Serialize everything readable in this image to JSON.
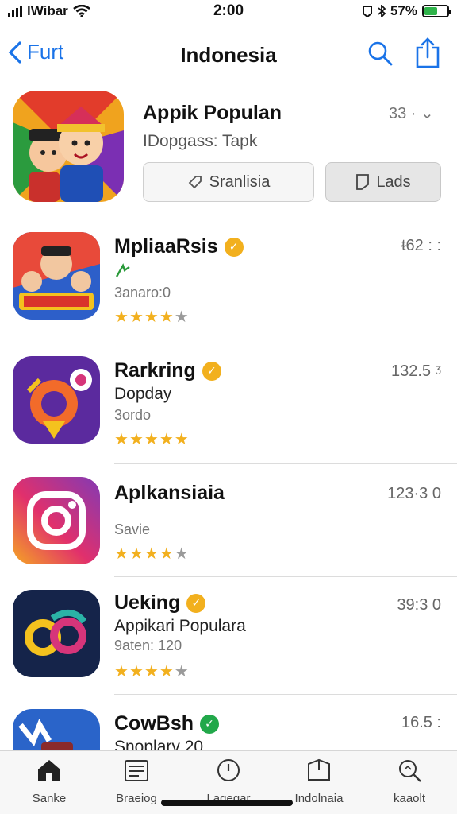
{
  "status_bar": {
    "carrier": "lWibar",
    "time": "2:00",
    "battery_text": "57%",
    "battery_level": 0.57,
    "battery_color": "#2fb34a"
  },
  "nav": {
    "back_label": "Furt",
    "title": "Indonesia",
    "accent_color": "#1a73e8"
  },
  "featured": {
    "name": "Appik Populan",
    "subtitle": "IDopgass: Tapk",
    "meta": "33 · ⌄",
    "button1_label": "Sranlisia",
    "button2_label": "Lads",
    "icon": "app-art-characters"
  },
  "apps": [
    {
      "name": "MpliaaRsis",
      "line2": "",
      "line3": "3anaro:0",
      "meta": "ᵵ62 : :",
      "rating": 3.5,
      "badge": "gold",
      "icon": "game-characters-icon"
    },
    {
      "name": "Rarkring",
      "line2": "Dopday",
      "line3": "3ordo",
      "meta": "132.5 ᶾ",
      "rating": 4.5,
      "badge": "gold",
      "icon": "location-pin-app-icon"
    },
    {
      "name": "Aplkansiaia",
      "line2": "",
      "line3": "Savie",
      "meta": "123·3 0",
      "rating": 4,
      "badge": "",
      "icon": "camera-app-icon"
    },
    {
      "name": "Ueking",
      "line2": "Appikari Populara",
      "line3": "9aten: 120",
      "meta": "39:3 0",
      "rating": 4,
      "badge": "gold",
      "icon": "swirl-app-icon"
    },
    {
      "name": "CowBsh",
      "line2": "Snoplary 20",
      "line3": "",
      "meta": "16.5 :",
      "rating": 0,
      "badge": "green",
      "icon": "cowbsh-app-icon"
    }
  ],
  "tabs": [
    {
      "label": "Sanke",
      "icon": "home-icon"
    },
    {
      "label": "Braeiog",
      "icon": "categories-icon"
    },
    {
      "label": "Lagegar",
      "icon": "clock-icon"
    },
    {
      "label": "Indolnaia",
      "icon": "box-icon"
    },
    {
      "label": "kaaolt",
      "icon": "search-icon"
    }
  ]
}
